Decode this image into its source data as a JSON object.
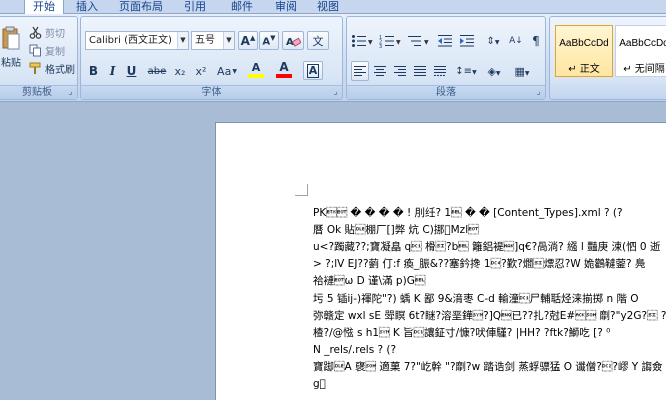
{
  "tabs": [
    {
      "label": "开始",
      "active": true
    },
    {
      "label": "插入",
      "active": false
    },
    {
      "label": "页面布局",
      "active": false
    },
    {
      "label": "引用",
      "active": false
    },
    {
      "label": "邮件",
      "active": false
    },
    {
      "label": "审阅",
      "active": false
    },
    {
      "label": "视图",
      "active": false
    }
  ],
  "clipboard": {
    "paste_label": "粘贴",
    "cut_label": "剪切",
    "copy_label": "复制",
    "format_painter_label": "格式刷",
    "group_label": "剪贴板"
  },
  "font": {
    "font_name": "Calibri (西文正文)",
    "font_size": "五号",
    "group_label": "字体",
    "format_buttons": [
      "B",
      "I",
      "U",
      "abe",
      "x₂",
      "x²",
      "Aa",
      "A",
      "A",
      "A"
    ],
    "highlight_color": "#ffff00",
    "font_color": "#ff0000"
  },
  "paragraph": {
    "group_label": "段落"
  },
  "styles": {
    "items": [
      {
        "sample": "AaBbCcDd",
        "name": "↵ 正文",
        "selected": true
      },
      {
        "sample": "AaBbCcDd",
        "name": "↵ 无间隔",
        "selected": false
      }
    ]
  },
  "document": {
    "lines": [
      "PK\u0003\u0004 � � � �  ! 刖纴? 1\u0007 � � [Content_Types].xml ? (?",
      "曆 Ok 貼\u0010棚厂[]弊 炕 C)挪\u0000Mzl\u0004",
      "u<?躅藏??;寶凝皛 q\u0011 榾\u000f?b\u0007 籬鋁褆\u0015]q€?咼淌? 繦 l 豔庚 涑(怬 0 逝",
      "> ?;lV EJ??藰 仃:f 瘓_脤&??塞鈐搀 1\u0014?歏?爓\u000f熛忍?W 姽鸛韃蓥?  鳧",
      "祫褳\u0004ω D 谨\\滿 p)G\u0007",
      "圬 5 锸ij-)禈陀\"?)    蝺 K 鄙 9&湇枣 C-d 輸潼\u0011尸輔聒烃涞揃掷 n    階 O",
      "弥赣定 wxl sE 斝瞑 6t?瞇?溶垩鏵\u0016?]Q\u0005已??扎?尅E#\u0006\u0001 劘?\"y2G?\u000f ?0`&<",
      "楂?/@惤 s     h1\u0016 K 旨\u0011讓鉦寸/慷?吠俥騹? |HH? ?ftk?鰤吃    [?     ⁰",
      "N       _rels/.rels ? (?",
      "寶踋\u0010A 襃\u0001 適菓 7?\"屹幹    \"?劘?w 踏诰剑 蒸蜉骠猛 O 谶僧?\u0012?嵺 Y 謅僉",
      "g\u0000"
    ]
  }
}
